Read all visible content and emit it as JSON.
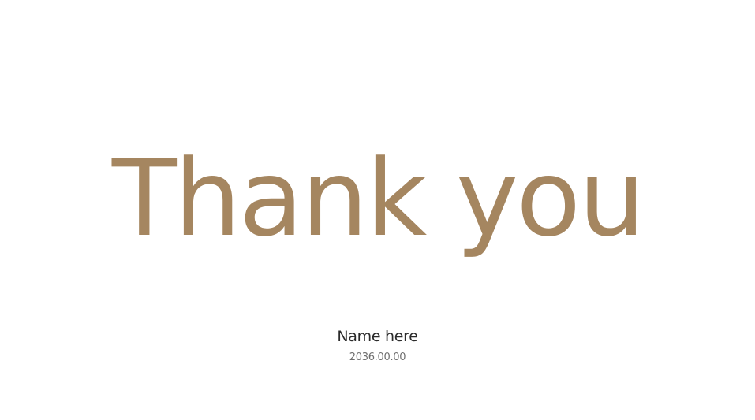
{
  "slide": {
    "title": "Thank you",
    "name": "Name here",
    "date": "2036.00.00"
  },
  "colors": {
    "title": "#a58660",
    "name": "#2b2b2b",
    "date": "#6f6f6f",
    "background": "#ffffff"
  }
}
